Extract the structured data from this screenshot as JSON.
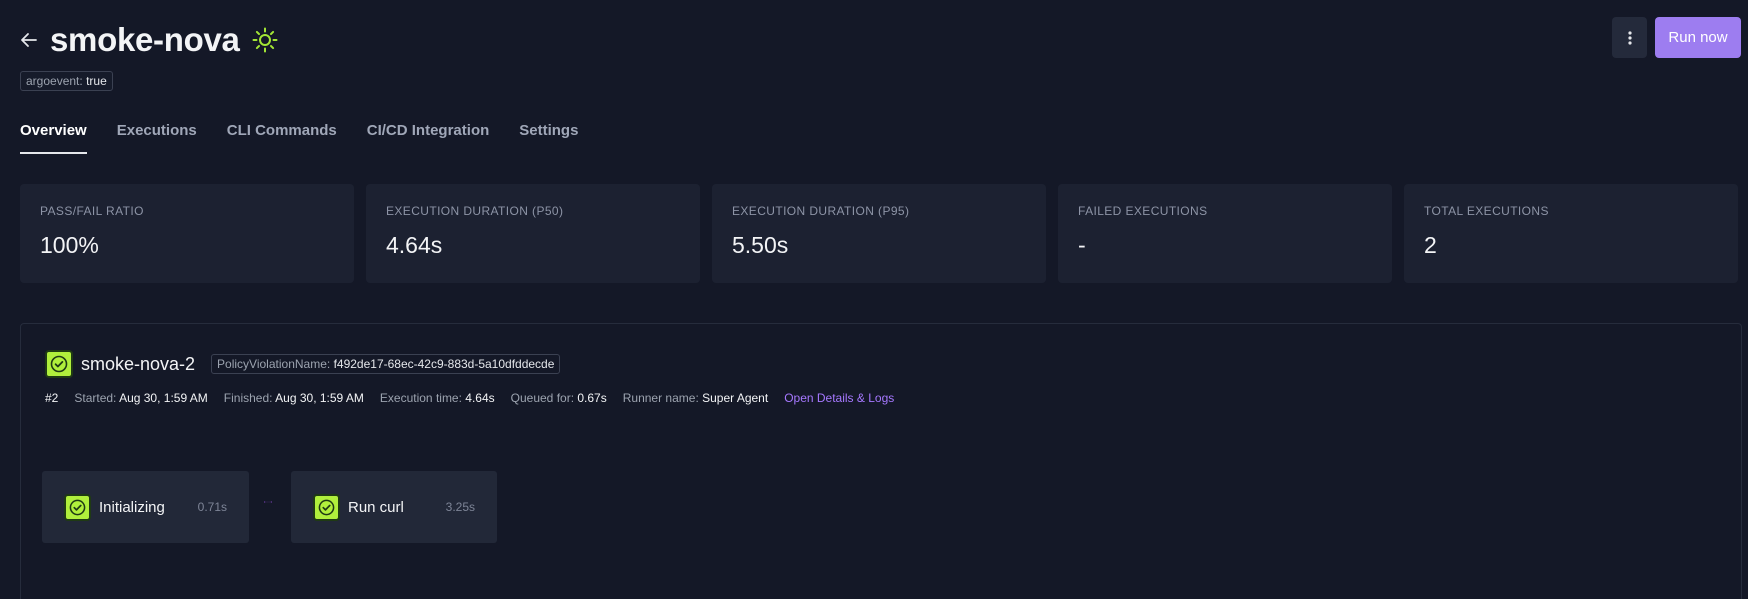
{
  "header": {
    "title": "smoke-nova",
    "back_icon": "arrow-left-icon",
    "status_icon": "sun-icon",
    "status_color": "#a3e635"
  },
  "label": {
    "key": "argoevent:",
    "value": "true"
  },
  "actions": {
    "more_icon": "kebab-icon",
    "run_label": "Run now",
    "accent": "#9d7df0"
  },
  "tabs": [
    {
      "label": "Overview",
      "active": true
    },
    {
      "label": "Executions"
    },
    {
      "label": "CLI Commands"
    },
    {
      "label": "CI/CD Integration"
    },
    {
      "label": "Settings"
    }
  ],
  "stats": [
    {
      "label": "PASS/FAIL RATIO",
      "value": "100%"
    },
    {
      "label": "EXECUTION DURATION (P50)",
      "value": "4.64s"
    },
    {
      "label": "EXECUTION DURATION (P95)",
      "value": "5.50s"
    },
    {
      "label": "FAILED EXECUTIONS",
      "value": "-"
    },
    {
      "label": "TOTAL EXECUTIONS",
      "value": "2"
    }
  ],
  "execution": {
    "name": "smoke-nova-2",
    "status_icon": "check-circle-icon",
    "policy_key": "PolicyViolationName:",
    "policy_value": "f492de17-68ec-42c9-883d-5a10dfddecde",
    "number": "#2",
    "started_label": "Started:",
    "started_value": "Aug 30, 1:59 AM",
    "finished_label": "Finished:",
    "finished_value": "Aug 30, 1:59 AM",
    "exec_time_label": "Execution time:",
    "exec_time_value": "4.64s",
    "queued_label": "Queued for:",
    "queued_value": "0.67s",
    "runner_label": "Runner name:",
    "runner_value": "Super Agent",
    "link_label": "Open Details & Logs",
    "success_color": "#b0ef3c",
    "connector_color": "#a855f7"
  },
  "steps": [
    {
      "name": "Initializing",
      "time": "0.71s"
    },
    {
      "name": "Run curl",
      "time": "3.25s"
    }
  ]
}
